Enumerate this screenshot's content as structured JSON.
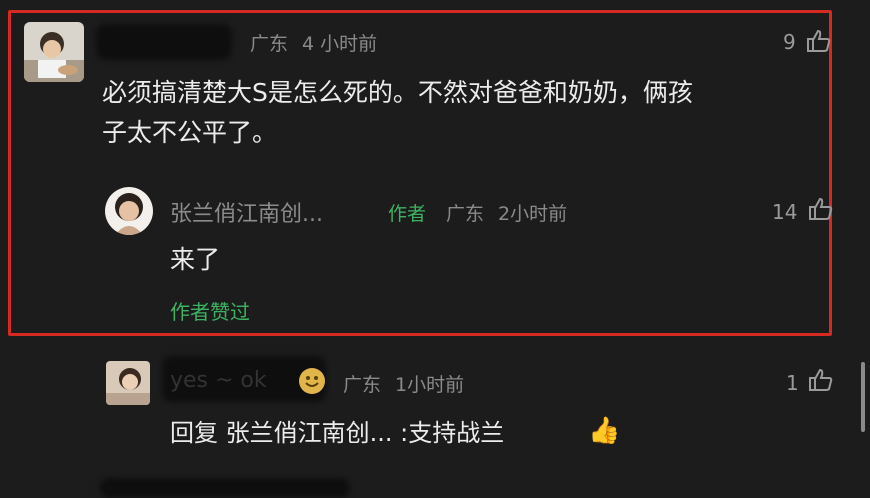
{
  "comments": [
    {
      "region": "广东",
      "time": "4 小时前",
      "likes": "9",
      "text_line1": "必须搞清楚大S是怎么死的。不然对爸爸和奶奶，俩孩",
      "text_line2": "子太不公平了。"
    }
  ],
  "reply": {
    "username": "张兰俏江南创...",
    "author_tag": "作者",
    "region": "广东",
    "time": "2小时前",
    "likes": "14",
    "text": "来了",
    "author_liked": "作者赞过"
  },
  "reply2": {
    "username": "yes ~ ok",
    "region": "广东",
    "time": "1小时前",
    "likes": "1",
    "text": "回复 张兰俏江南创... :支持战兰",
    "emoji": "👍"
  },
  "colors": {
    "highlight": "#d42a22",
    "author_green": "#3db361",
    "background": "#1c1c1c"
  }
}
